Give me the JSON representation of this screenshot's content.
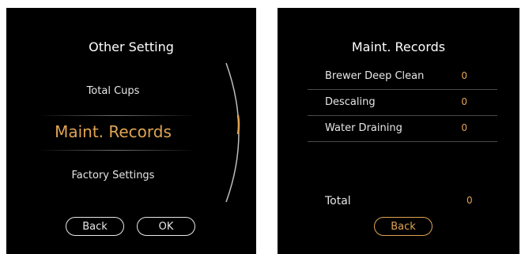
{
  "left_screen": {
    "title": "Other Setting",
    "menu": [
      {
        "label": "Total Cups"
      },
      {
        "label": "Maint. Records",
        "selected": true
      },
      {
        "label": "Factory Settings"
      }
    ],
    "buttons": {
      "back": "Back",
      "ok": "OK"
    }
  },
  "right_screen": {
    "title": "Maint. Records",
    "rows": [
      {
        "label": "Brewer Deep Clean",
        "value": "0"
      },
      {
        "label": "Descaling",
        "value": "0"
      },
      {
        "label": "Water Draining",
        "value": "0"
      }
    ],
    "total": {
      "label": "Total",
      "value": "0"
    },
    "buttons": {
      "back": "Back"
    }
  },
  "colors": {
    "background": "#000000",
    "accent": "#e0a453",
    "text": "#e6e6e6"
  }
}
